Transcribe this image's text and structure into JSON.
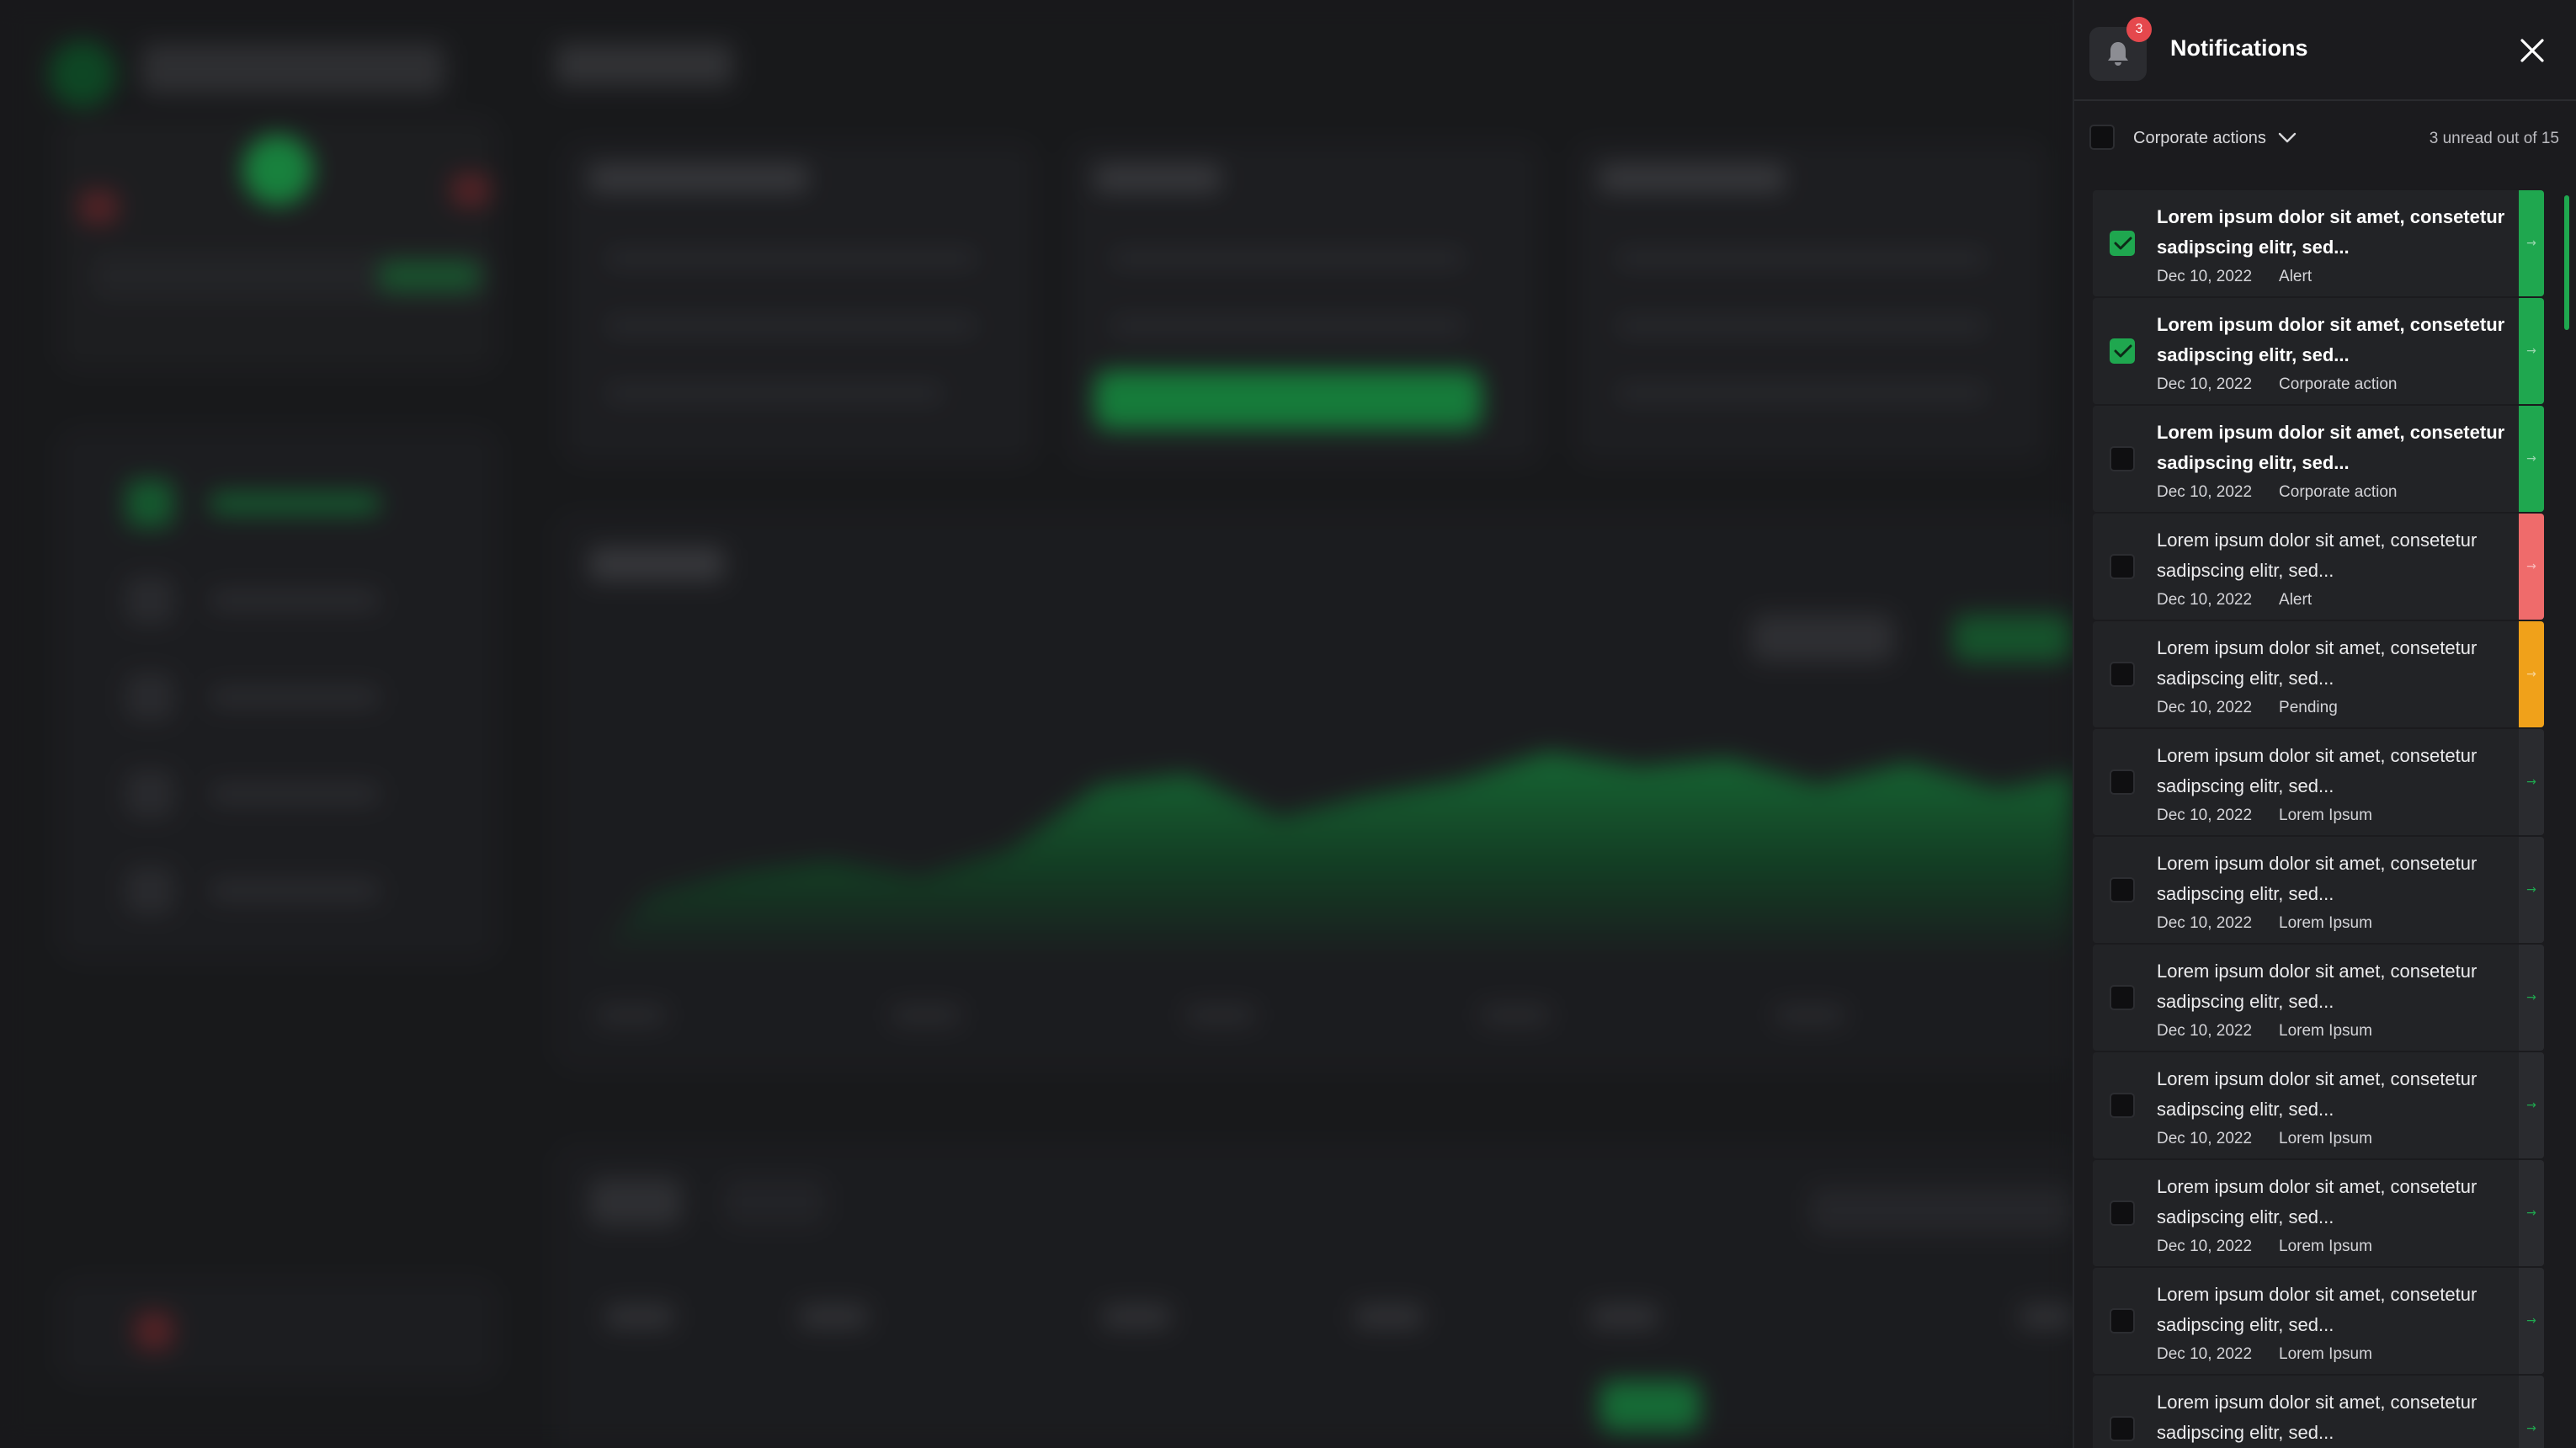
{
  "panel": {
    "title": "Notifications",
    "badge_count": "3",
    "filter_label": "Corporate actions",
    "unread_text": "3 unread out of 15"
  },
  "colors": {
    "accent_green": "#1fa74f",
    "alert_red": "#ef6b6b",
    "pending_orange": "#f0a11a",
    "badge_red": "#e5484d"
  },
  "notifications": [
    {
      "text": "Lorem ipsum dolor sit amet, consetetur sadipscing elitr, sed...",
      "date": "Dec 10, 2022",
      "category": "Alert",
      "unread": true,
      "checked": true,
      "strip": "green"
    },
    {
      "text": "Lorem ipsum dolor sit amet, consetetur sadipscing elitr, sed...",
      "date": "Dec 10, 2022",
      "category": "Corporate action",
      "unread": true,
      "checked": true,
      "strip": "green"
    },
    {
      "text": "Lorem ipsum dolor sit amet, consetetur sadipscing elitr, sed...",
      "date": "Dec 10, 2022",
      "category": "Corporate action",
      "unread": true,
      "checked": false,
      "strip": "green"
    },
    {
      "text": "Lorem ipsum dolor sit amet, consetetur sadipscing elitr, sed...",
      "date": "Dec 10, 2022",
      "category": "Alert",
      "unread": false,
      "checked": false,
      "strip": "red"
    },
    {
      "text": "Lorem ipsum dolor sit amet, consetetur sadipscing elitr, sed...",
      "date": "Dec 10, 2022",
      "category": "Pending",
      "unread": false,
      "checked": false,
      "strip": "orange"
    },
    {
      "text": "Lorem ipsum dolor sit amet, consetetur sadipscing elitr, sed...",
      "date": "Dec 10, 2022",
      "category": "Lorem Ipsum",
      "unread": false,
      "checked": false,
      "strip": "none"
    },
    {
      "text": "Lorem ipsum dolor sit amet, consetetur sadipscing elitr, sed...",
      "date": "Dec 10, 2022",
      "category": "Lorem Ipsum",
      "unread": false,
      "checked": false,
      "strip": "none"
    },
    {
      "text": "Lorem ipsum dolor sit amet, consetetur sadipscing elitr, sed...",
      "date": "Dec 10, 2022",
      "category": "Lorem Ipsum",
      "unread": false,
      "checked": false,
      "strip": "none"
    },
    {
      "text": "Lorem ipsum dolor sit amet, consetetur sadipscing elitr, sed...",
      "date": "Dec 10, 2022",
      "category": "Lorem Ipsum",
      "unread": false,
      "checked": false,
      "strip": "none"
    },
    {
      "text": "Lorem ipsum dolor sit amet, consetetur sadipscing elitr, sed...",
      "date": "Dec 10, 2022",
      "category": "Lorem Ipsum",
      "unread": false,
      "checked": false,
      "strip": "none"
    },
    {
      "text": "Lorem ipsum dolor sit amet, consetetur sadipscing elitr, sed...",
      "date": "Dec 10, 2022",
      "category": "Lorem Ipsum",
      "unread": false,
      "checked": false,
      "strip": "none"
    },
    {
      "text": "Lorem ipsum dolor sit amet, consetetur sadipscing elitr, sed...",
      "date": "",
      "category": "",
      "unread": false,
      "checked": false,
      "strip": "none"
    }
  ]
}
